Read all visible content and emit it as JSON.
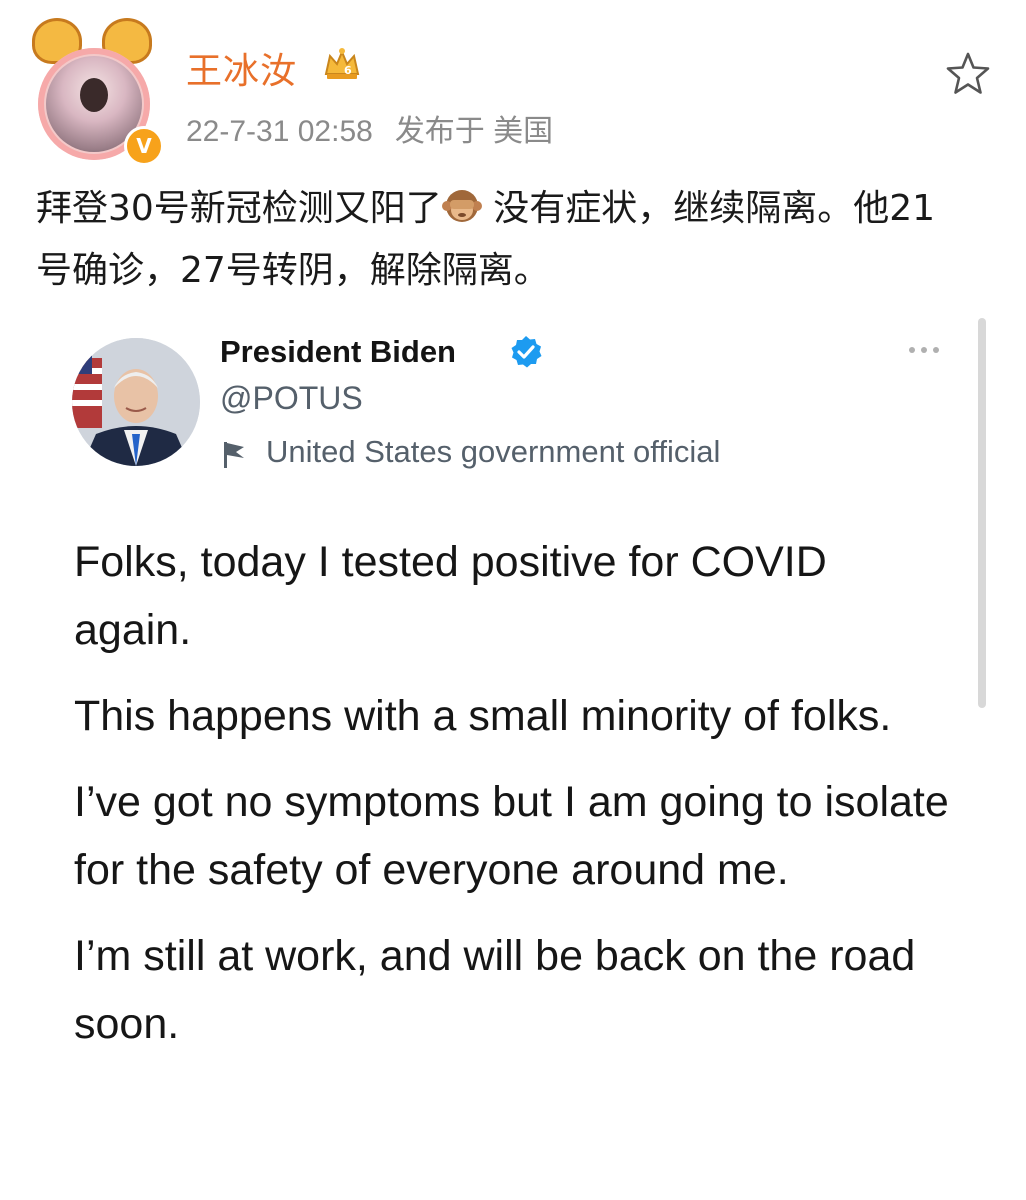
{
  "post": {
    "username": "王冰汝",
    "timestamp": "22-7-31 02:58",
    "location_label": "发布于 美国",
    "text_before_emoji": "拜登30号新冠检测又阳了",
    "text_after_emoji": " 没有症状，继续隔离。他21号确诊，27号转阴，解除隔离。",
    "badge_letter": "V",
    "colors": {
      "username": "#e8702a",
      "meta": "#8a8a8a",
      "badge": "#f7a21b"
    }
  },
  "tweet": {
    "name": "President Biden",
    "handle": "@POTUS",
    "gov_label": "United States government official",
    "paragraphs": [
      "Folks, today I tested positive for COVID again.",
      "This happens with a small minority of folks.",
      "I’ve got no symptoms but I am going to isolate for the safety of everyone around me.",
      "I’m still at work, and will be back on the road soon."
    ],
    "colors": {
      "verified": "#1d9bf0",
      "secondary_text": "#55606b"
    }
  },
  "icons": {
    "crown": "crown-icon",
    "star": "star-icon",
    "verified": "verified-check-icon",
    "flag": "flag-icon",
    "more": "more-dots-icon",
    "emoji": "see-no-evil-monkey-emoji"
  }
}
